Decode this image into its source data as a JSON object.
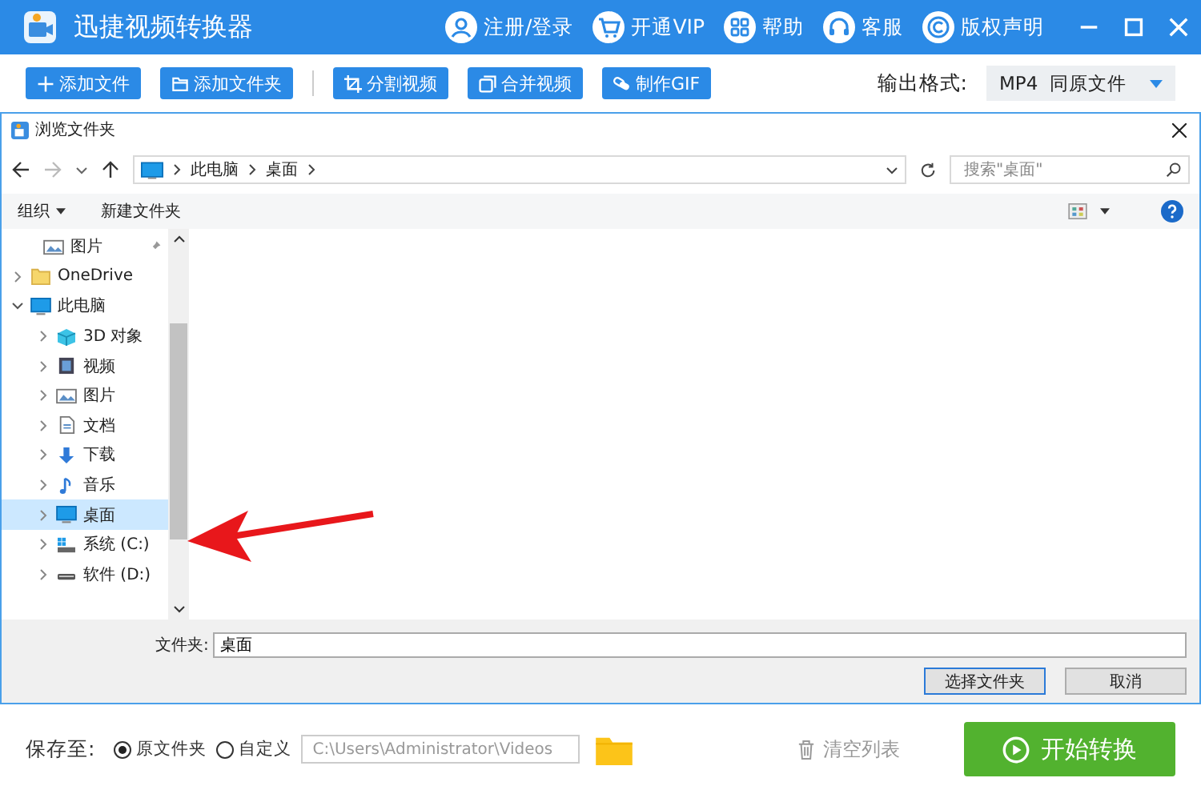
{
  "app": {
    "title": "迅捷视频转换器",
    "nav": [
      {
        "kind": "user",
        "label": "注册/登录"
      },
      {
        "kind": "cart",
        "label": "开通VIP"
      },
      {
        "kind": "grid",
        "label": "帮助"
      },
      {
        "kind": "headset",
        "label": "客服"
      },
      {
        "kind": "copyright",
        "label": "版权声明"
      }
    ]
  },
  "toolbar": {
    "buttons": [
      {
        "kind": "plus",
        "label": "添加文件"
      },
      {
        "kind": "folder",
        "label": "添加文件夹"
      },
      {
        "kind": "crop",
        "label": "分割视频"
      },
      {
        "kind": "merge",
        "label": "合并视频"
      },
      {
        "kind": "gif",
        "label": "制作GIF"
      }
    ],
    "format_label": "输出格式:",
    "format_value": "MP4  同原文件"
  },
  "dialog": {
    "title": "浏览文件夹",
    "path": [
      "此电脑",
      "桌面"
    ],
    "search_placeholder": "搜索\"桌面\"",
    "organize": "组织",
    "new_folder": "新建文件夹",
    "tree": [
      {
        "kind": "picture",
        "label": "图片",
        "pinned": true,
        "selected": false
      },
      {
        "kind": "folder",
        "label": "OneDrive",
        "expanded": false,
        "selected": false
      },
      {
        "kind": "pc",
        "label": "此电脑",
        "expanded": true,
        "selected": false,
        "children": [
          {
            "kind": "cube",
            "label": "3D 对象",
            "selected": false
          },
          {
            "kind": "video",
            "label": "视频",
            "selected": false
          },
          {
            "kind": "picture",
            "label": "图片",
            "selected": false
          },
          {
            "kind": "doc",
            "label": "文档",
            "selected": false
          },
          {
            "kind": "download",
            "label": "下载",
            "selected": false
          },
          {
            "kind": "music",
            "label": "音乐",
            "selected": false
          },
          {
            "kind": "desktop",
            "label": "桌面",
            "selected": true
          },
          {
            "kind": "sysdrive",
            "label": "系统 (C:)",
            "selected": false
          },
          {
            "kind": "drive",
            "label": "软件 (D:)",
            "selected": false
          }
        ]
      }
    ],
    "folder_label": "文件夹:",
    "folder_value": "桌面",
    "ok": "选择文件夹",
    "cancel": "取消"
  },
  "bottom": {
    "save_label": "保存至:",
    "save_options": [
      {
        "label": "原文件夹",
        "selected": true
      },
      {
        "label": "自定义",
        "selected": false
      }
    ],
    "path": "C:\\Users\\Administrator\\Videos",
    "clear": "清空列表",
    "start": "开始转换"
  }
}
